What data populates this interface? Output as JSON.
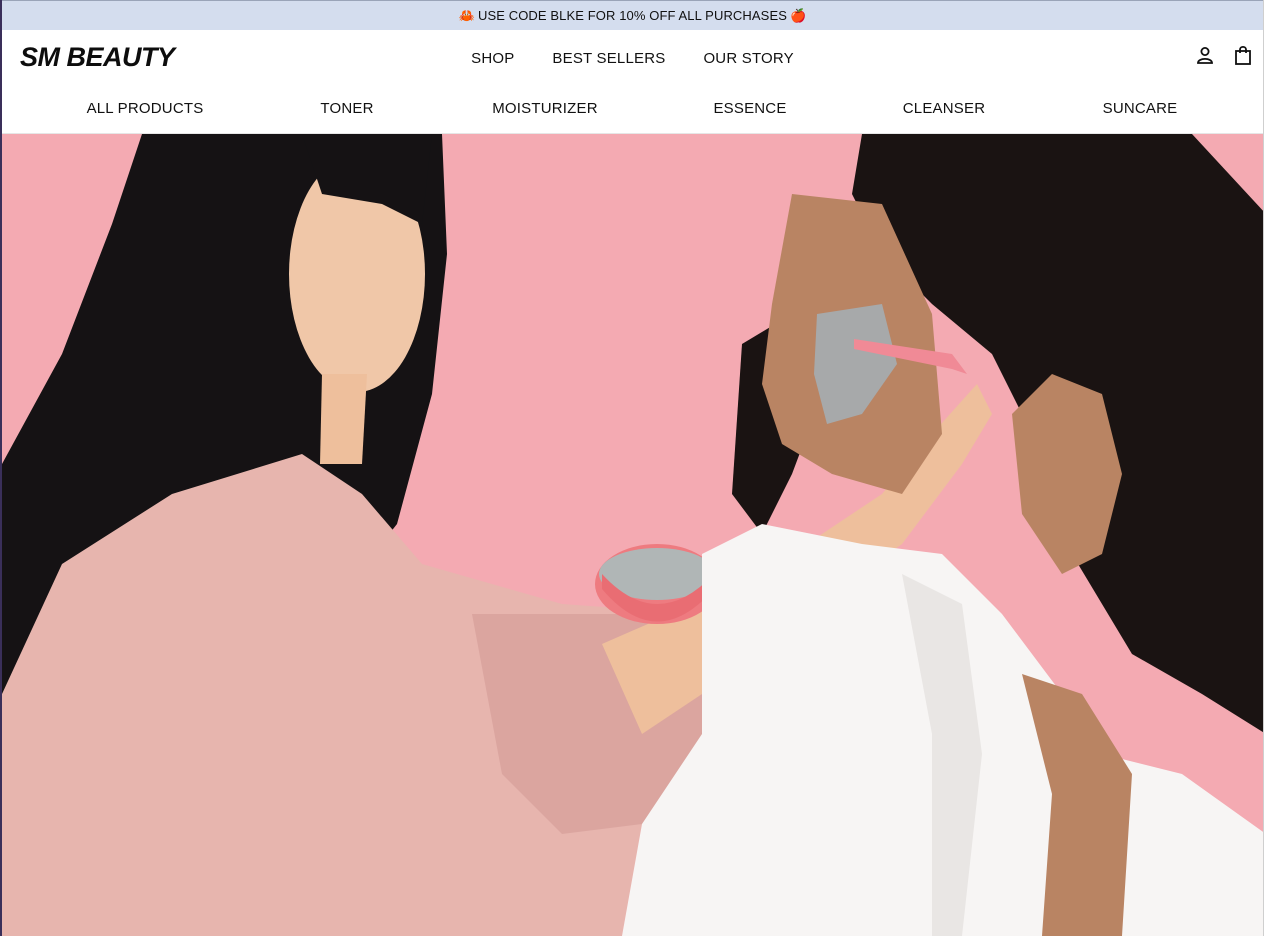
{
  "promo": {
    "text": "USE CODE BLKE FOR 10% OFF ALL PURCHASES",
    "left_emoji": "🦀",
    "right_emoji": "🍎"
  },
  "header": {
    "logo": "SM BEAUTY",
    "main_nav": [
      {
        "label": "SHOP"
      },
      {
        "label": "BEST SELLERS"
      },
      {
        "label": "OUR STORY"
      }
    ],
    "icons": [
      "account-icon",
      "shopping-bag-icon"
    ]
  },
  "categories": [
    {
      "label": "ALL PRODUCTS"
    },
    {
      "label": "TONER"
    },
    {
      "label": "MOISTURIZER"
    },
    {
      "label": "ESSENCE"
    },
    {
      "label": "CLEANSER"
    },
    {
      "label": "SUNCARE"
    }
  ],
  "hero": {
    "background_color": "#f4aab2",
    "description_icon": "hero-image"
  },
  "colors": {
    "promo_bg": "#d4ddee",
    "hero_bg": "#f4aab2",
    "text": "#111111"
  }
}
